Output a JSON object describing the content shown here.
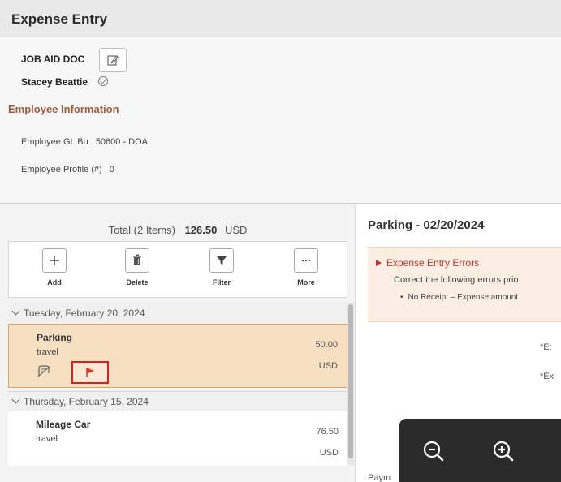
{
  "header": {
    "title": "Expense Entry"
  },
  "report": {
    "name": "JOB AID DOC",
    "employee_name": "Stacey Beattie"
  },
  "employee_info": {
    "heading": "Employee Information",
    "gl_bu_label": "Employee GL Bu",
    "gl_bu_value": "50600 - DOA",
    "profile_label": "Employee Profile (#)",
    "profile_value": "0"
  },
  "summary": {
    "label": "Total (2 Items)",
    "amount": "126.50",
    "currency": "USD"
  },
  "toolbar": {
    "add_label": "Add",
    "delete_label": "Delete",
    "filter_label": "Filter",
    "more_label": "More"
  },
  "days": [
    {
      "date": "Tuesday, February 20, 2024"
    },
    {
      "date": "Thursday, February 15, 2024"
    }
  ],
  "expenses": [
    {
      "type": "Parking",
      "purpose": "travel",
      "amount": "50.00",
      "currency": "USD",
      "selected": true,
      "flagged": true
    },
    {
      "type": "Mileage Car",
      "purpose": "travel",
      "amount": "76.50",
      "currency": "USD",
      "selected": false,
      "flagged": false
    }
  ],
  "detail": {
    "title": "Parking - 02/20/2024",
    "error_heading": "Expense Entry Errors",
    "error_text": "Correct the following errors prio",
    "error_bullet": "No Receipt – Expense amount",
    "required_1": "*E:",
    "required_2": "*Ex",
    "payment_label": "Paym"
  },
  "colors": {
    "accent": "#a15a3c",
    "error": "#c0392b",
    "selected_bg": "#f7dfc2",
    "flag_highlight": "#e01c1c"
  }
}
